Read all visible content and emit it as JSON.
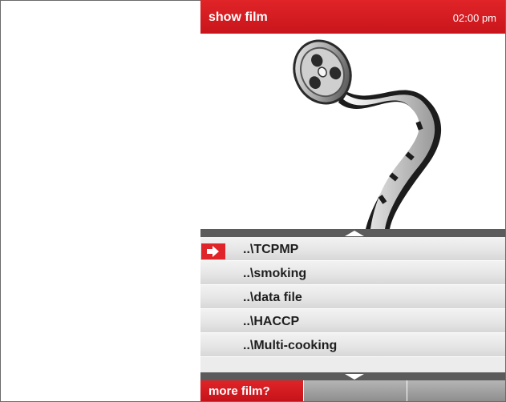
{
  "header": {
    "title": "show film",
    "time": "02:00 pm"
  },
  "files": [
    {
      "label": "..\\TCPMP",
      "selected": true
    },
    {
      "label": "..\\smoking",
      "selected": false
    },
    {
      "label": "..\\data file",
      "selected": false
    },
    {
      "label": "..\\HACCP",
      "selected": false
    },
    {
      "label": "..\\Multi-cooking",
      "selected": false
    }
  ],
  "icons": {
    "illustration": "film-reel-icon",
    "scroll_up": "scroll-up-arrow-icon",
    "scroll_down": "scroll-down-arrow-icon",
    "selection": "arrow-right-icon"
  },
  "footer": {
    "more_label": "more film?"
  },
  "colors": {
    "accent": "#d41d22",
    "separator": "#5b5b5b",
    "row_light": "#ececec"
  }
}
